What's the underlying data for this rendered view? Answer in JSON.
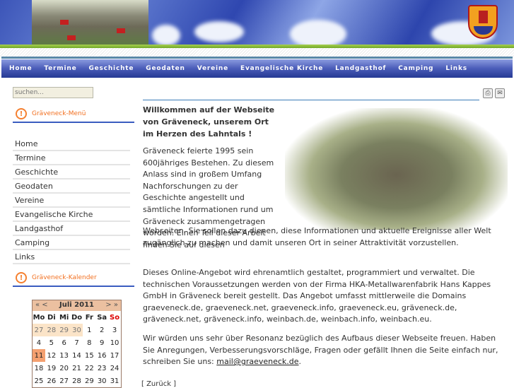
{
  "nav": [
    "Home",
    "Termine",
    "Geschichte",
    "Geodaten",
    "Vereine",
    "Evangelische Kirche",
    "Landgasthof",
    "Camping",
    "Links"
  ],
  "search": {
    "placeholder": "suchen..."
  },
  "menu_title": "Gräveneck-Menü",
  "menu": [
    "Home",
    "Termine",
    "Geschichte",
    "Geodaten",
    "Vereine",
    "Evangelische Kirche",
    "Landgasthof",
    "Camping",
    "Links"
  ],
  "calendar_title": "Gräveneck-Kalender",
  "calendar": {
    "prev": "« <",
    "month": "Juli 2011",
    "next": "> »",
    "days": [
      "Mo",
      "Di",
      "Mi",
      "Do",
      "Fr",
      "Sa",
      "So"
    ],
    "weeks": [
      [
        "27",
        "28",
        "29",
        "30",
        "1",
        "2",
        "3"
      ],
      [
        "4",
        "5",
        "6",
        "7",
        "8",
        "9",
        "10"
      ],
      [
        "11",
        "12",
        "13",
        "14",
        "15",
        "16",
        "17"
      ],
      [
        "18",
        "19",
        "20",
        "21",
        "22",
        "23",
        "24"
      ],
      [
        "25",
        "26",
        "27",
        "28",
        "29",
        "30",
        "31"
      ]
    ],
    "today": "11",
    "sunday_color": "#dd0000"
  },
  "main": {
    "icons": [
      "print-icon",
      "email-icon"
    ],
    "welcome": "Willkommen auf der Webseite von Gräveneck, unserem Ort im Herzen des Lahntals !",
    "p1a": "Gräveneck feierte 1995 sein 600jähriges Bestehen. Zu diesem Anlass sind in großem Umfang Nachforschungen zu der Geschichte angestellt und sämtliche Informationen rund um Gräveneck zusammengetragen worden. Einen Teil dieser Arbeit finden Sie auf diesen",
    "p1b": "Webseiten. Sie sollen dazu dienen, diese Informationen und aktuelle Ereignisse aller Welt zugänglich zu machen und damit unseren Ort in seiner Attraktivität vorzustellen.",
    "p2": "Dieses Online-Angebot wird ehrenamtlich gestaltet, programmiert und verwaltet. Die technischen Voraussetzungen werden von der Firma HKA-Metallwarenfabrik Hans Kappes GmbH in Gräveneck bereit gestellt. Das Angebot umfasst mittlerweile die Domains graeveneck.de, graeveneck.net, graeveneck.info, graeveneck.eu, gräveneck.de, gräveneck.net, gräveneck.info, weinbach.de, weinbach.info, weinbach.eu.",
    "p3": "Wir würden uns sehr über Resonanz bezüglich des Aufbaus dieser Webseite freuen. Haben Sie Anregungen, Verbesserungsvorschläge, Fragen oder gefällt Ihnen die Seite einfach nur, schreiben Sie uns: ",
    "email": "mail@graeveneck.de",
    "back": "[ Zurück ]"
  }
}
